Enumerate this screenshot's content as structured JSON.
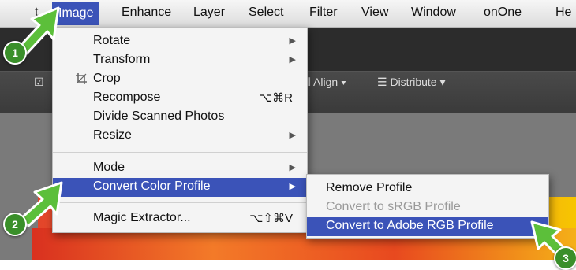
{
  "menubar": {
    "items": [
      "t",
      "Image",
      "Enhance",
      "Layer",
      "Select",
      "Filter",
      "View",
      "Window",
      "onOne",
      "He"
    ]
  },
  "toolbar": {
    "align_label": "Align",
    "distribute_label": "Distribute"
  },
  "image_menu": {
    "items": [
      {
        "label": "Rotate"
      },
      {
        "label": "Transform"
      },
      {
        "label": "Crop"
      },
      {
        "label": "Recompose",
        "shortcut": "⌥⌘R"
      },
      {
        "label": "Divide Scanned Photos"
      },
      {
        "label": "Resize"
      },
      {
        "label": "Mode"
      },
      {
        "label": "Convert Color Profile"
      },
      {
        "label": "Magic Extractor...",
        "shortcut": "⌥⇧⌘V"
      }
    ]
  },
  "submenu": {
    "items": [
      {
        "label": "Remove Profile"
      },
      {
        "label": "Convert to sRGB Profile"
      },
      {
        "label": "Convert to Adobe RGB Profile"
      }
    ]
  },
  "callouts": [
    "1",
    "2",
    "3"
  ],
  "colors": {
    "highlight": "#3b53b8",
    "callout_green": "#3a8f2a"
  }
}
